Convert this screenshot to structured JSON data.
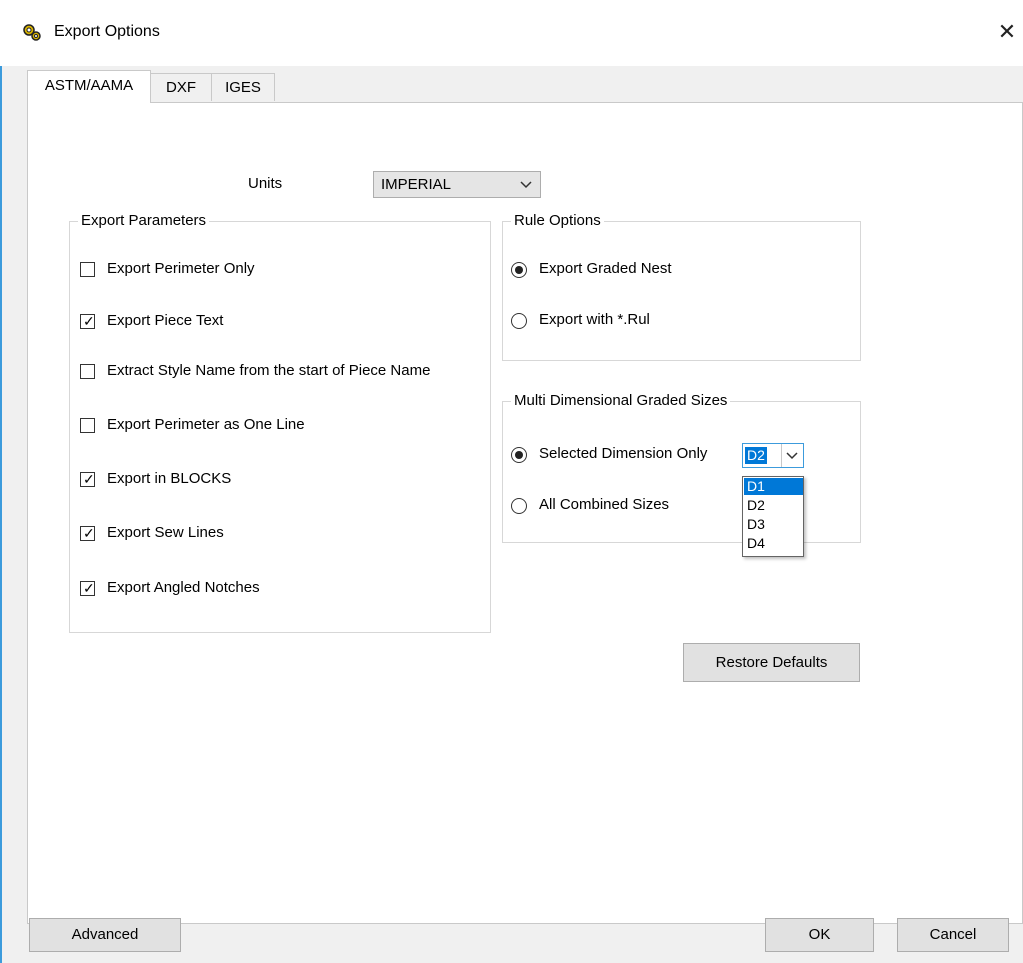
{
  "window": {
    "title": "Export Options",
    "icon": "gears-icon",
    "close": "✕"
  },
  "tabs": [
    {
      "label": "ASTM/AAMA",
      "active": true
    },
    {
      "label": "DXF",
      "active": false
    },
    {
      "label": "IGES",
      "active": false
    }
  ],
  "units": {
    "label": "Units",
    "value": "IMPERIAL"
  },
  "export_parameters": {
    "legend": "Export Parameters",
    "items": [
      {
        "label": "Export Perimeter Only",
        "checked": false
      },
      {
        "label": "Export Piece Text",
        "checked": true
      },
      {
        "label": "Extract Style Name from the start of Piece Name",
        "checked": false
      },
      {
        "label": "Export Perimeter as One Line",
        "checked": false
      },
      {
        "label": "Export in BLOCKS",
        "checked": true
      },
      {
        "label": "Export Sew Lines",
        "checked": true
      },
      {
        "label": "Export Angled Notches",
        "checked": true
      }
    ]
  },
  "rule_options": {
    "legend": "Rule Options",
    "options": [
      {
        "label": "Export Graded Nest",
        "selected": true
      },
      {
        "label": "Export with *.Rul",
        "selected": false
      }
    ]
  },
  "multi_dim": {
    "legend": "Multi Dimensional Graded Sizes",
    "options": [
      {
        "label": "Selected Dimension Only",
        "selected": true
      },
      {
        "label": "All Combined Sizes",
        "selected": false
      }
    ],
    "dimension_select": {
      "value": "D2",
      "options": [
        "D1",
        "D2",
        "D3",
        "D4"
      ],
      "highlighted": "D1"
    }
  },
  "buttons": {
    "restore_defaults": "Restore Defaults",
    "advanced": "Advanced",
    "ok": "OK",
    "cancel": "Cancel"
  },
  "colors": {
    "accent": "#3c9bdc",
    "selection": "#0078d7"
  }
}
